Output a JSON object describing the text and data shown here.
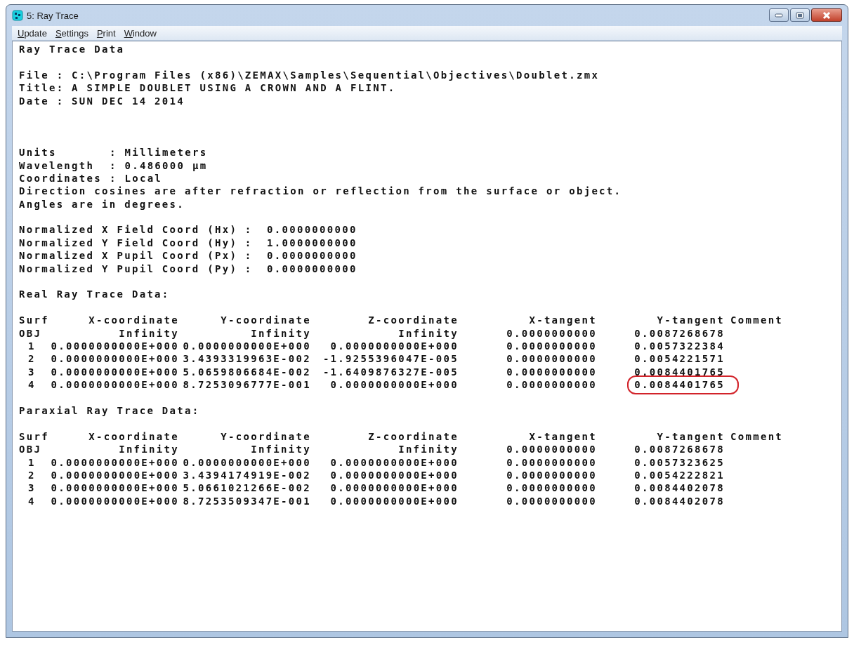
{
  "window": {
    "title": "5: Ray Trace"
  },
  "menu": [
    {
      "label": "Update"
    },
    {
      "label": "Settings"
    },
    {
      "label": "Print"
    },
    {
      "label": "Window"
    }
  ],
  "heading": "Ray Trace Data",
  "file_info": [
    "File : C:\\Program Files (x86)\\ZEMAX\\Samples\\Sequential\\Objectives\\Doublet.zmx",
    "Title: A SIMPLE DOUBLET USING A CROWN AND A FLINT.",
    "Date : SUN DEC 14 2014"
  ],
  "settings": [
    {
      "label": "Units",
      "value": ": Millimeters"
    },
    {
      "label": "Wavelength",
      "value": ": 0.486000 µm"
    },
    {
      "label": "Coordinates",
      "value": ": Local"
    }
  ],
  "notes": [
    "Direction cosines are after refraction or reflection from the surface or object.",
    "Angles are in degrees."
  ],
  "normalized": [
    {
      "label": "Normalized X Field Coord (Hx) :",
      "value": "0.0000000000"
    },
    {
      "label": "Normalized Y Field Coord (Hy) :",
      "value": "1.0000000000"
    },
    {
      "label": "Normalized X Pupil Coord (Px) :",
      "value": "0.0000000000"
    },
    {
      "label": "Normalized Y Pupil Coord (Py) :",
      "value": "0.0000000000"
    }
  ],
  "tables": [
    {
      "title": "Real Ray Trace Data:",
      "columns": [
        "Surf",
        "X-coordinate",
        "Y-coordinate",
        "Z-coordinate",
        "X-tangent",
        "Y-tangent",
        "Comment"
      ],
      "rows": [
        {
          "cells": [
            "OBJ",
            "Infinity",
            "Infinity",
            "Infinity",
            "0.0000000000",
            "0.0087268678"
          ],
          "circled": false
        },
        {
          "cells": [
            "1",
            "0.0000000000E+000",
            "0.0000000000E+000",
            "0.0000000000E+000",
            "0.0000000000",
            "0.0057322384"
          ],
          "circled": false
        },
        {
          "cells": [
            "2",
            "0.0000000000E+000",
            "3.4393319963E-002",
            "-1.9255396047E-005",
            "0.0000000000",
            "0.0054221571"
          ],
          "circled": false
        },
        {
          "cells": [
            "3",
            "0.0000000000E+000",
            "5.0659806684E-002",
            "-1.6409876327E-005",
            "0.0000000000",
            "0.0084401765"
          ],
          "circled": false
        },
        {
          "cells": [
            "4",
            "0.0000000000E+000",
            "8.7253096777E-001",
            "0.0000000000E+000",
            "0.0000000000",
            "0.0084401765"
          ],
          "circled": true
        }
      ]
    },
    {
      "title": "Paraxial Ray Trace Data:",
      "columns": [
        "Surf",
        "X-coordinate",
        "Y-coordinate",
        "Z-coordinate",
        "X-tangent",
        "Y-tangent",
        "Comment"
      ],
      "rows": [
        {
          "cells": [
            "OBJ",
            "Infinity",
            "Infinity",
            "Infinity",
            "0.0000000000",
            "0.0087268678"
          ],
          "circled": false
        },
        {
          "cells": [
            "1",
            "0.0000000000E+000",
            "0.0000000000E+000",
            "0.0000000000E+000",
            "0.0000000000",
            "0.0057323625"
          ],
          "circled": false
        },
        {
          "cells": [
            "2",
            "0.0000000000E+000",
            "3.4394174919E-002",
            "0.0000000000E+000",
            "0.0000000000",
            "0.0054222821"
          ],
          "circled": false
        },
        {
          "cells": [
            "3",
            "0.0000000000E+000",
            "5.0661021266E-002",
            "0.0000000000E+000",
            "0.0000000000",
            "0.0084402078"
          ],
          "circled": false
        },
        {
          "cells": [
            "4",
            "0.0000000000E+000",
            "8.7253509347E-001",
            "0.0000000000E+000",
            "0.0000000000",
            "0.0084402078"
          ],
          "circled": false
        }
      ]
    }
  ]
}
